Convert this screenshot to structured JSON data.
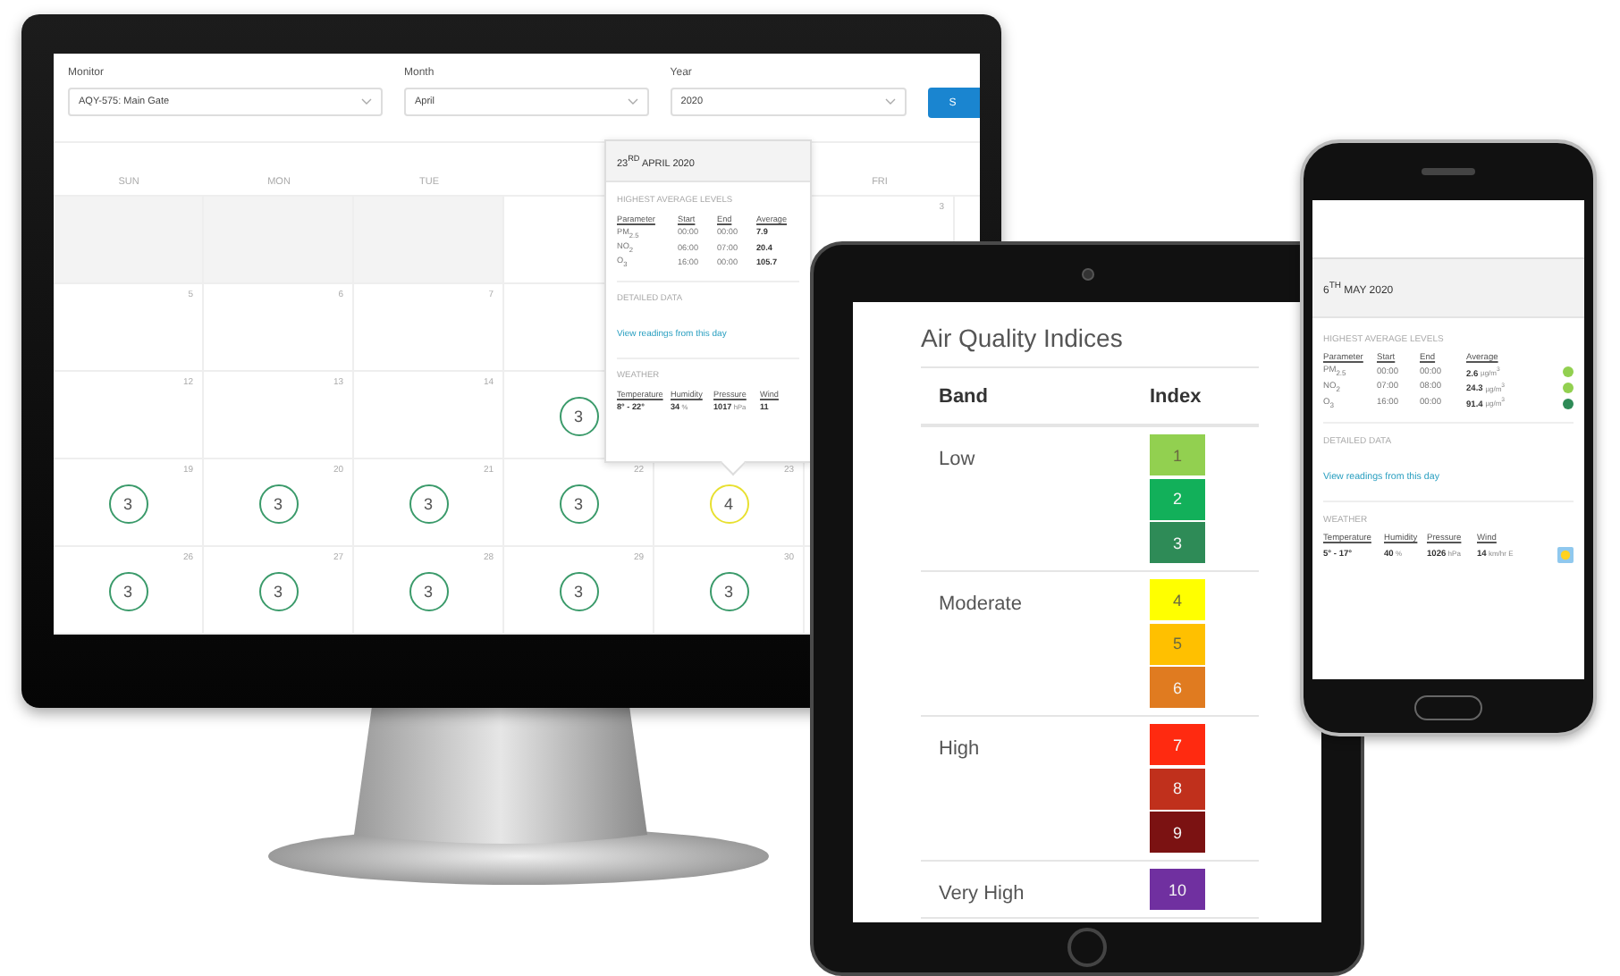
{
  "monitor": {
    "filters": [
      {
        "label": "Monitor",
        "value": "AQY-575: Main Gate"
      },
      {
        "label": "Month",
        "value": "April"
      },
      {
        "label": "Year",
        "value": "2020"
      }
    ],
    "submit_button": "S",
    "calendar": {
      "weekdays": [
        "SUN",
        "MON",
        "TUE",
        "FRI"
      ],
      "weeks": [
        {
          "days": [
            {
              "muted": true
            },
            {
              "muted": true
            },
            {
              "muted": true
            },
            {
              "muted": false
            }
          ],
          "end_days": [
            {
              "muted": false,
              "date": "3"
            }
          ]
        },
        {
          "days": [
            {
              "muted": false,
              "date": "5"
            },
            {
              "muted": false,
              "date": "6"
            },
            {
              "muted": false,
              "date": "7"
            },
            {
              "muted": false
            }
          ]
        },
        {
          "days": [
            {
              "muted": false,
              "date": "12"
            },
            {
              "muted": false,
              "date": "13"
            },
            {
              "muted": false,
              "date": "14"
            },
            {
              "muted": false,
              "index": "3",
              "color": "#3a9a6a"
            }
          ]
        },
        {
          "days": [
            {
              "muted": false,
              "date": "19",
              "index": "3",
              "color": "#3a9a6a"
            },
            {
              "muted": false,
              "date": "20",
              "index": "3",
              "color": "#3a9a6a"
            },
            {
              "muted": false,
              "date": "21",
              "index": "3",
              "color": "#3a9a6a"
            },
            {
              "muted": false,
              "date": "22",
              "index": "3",
              "color": "#3a9a6a"
            },
            {
              "muted": false,
              "date": "23",
              "index": "4",
              "color": "#e8e030"
            }
          ]
        },
        {
          "days": [
            {
              "muted": false,
              "date": "26",
              "index": "3",
              "color": "#3a9a6a"
            },
            {
              "muted": false,
              "date": "27",
              "index": "3",
              "color": "#3a9a6a"
            },
            {
              "muted": false,
              "date": "28",
              "index": "3",
              "color": "#3a9a6a"
            },
            {
              "muted": false,
              "date": "29",
              "index": "3",
              "color": "#3a9a6a"
            },
            {
              "muted": false,
              "date": "30",
              "index": "3",
              "color": "#3a9a6a"
            }
          ]
        }
      ]
    },
    "popover": {
      "date": "23$^{RD}$ APRIL 2020",
      "levels_heading": "HIGHEST AVERAGE LEVELS",
      "columns": [
        "Parameter",
        "Start",
        "End",
        "Average"
      ],
      "rows": [
        {
          "parameter": "PM$_{2.5}$",
          "start": "00:00",
          "end": "00:00",
          "average": "7.9"
        },
        {
          "parameter": "NO$_{2}$",
          "start": "06:00",
          "end": "07:00",
          "average": "20.4"
        },
        {
          "parameter": "O$_{3}$",
          "start": "16:00",
          "end": "00:00",
          "average": "105.7"
        }
      ],
      "detail_heading": "DETAILED DATA",
      "detail_link": "View readings from this day",
      "weather_heading": "WEATHER",
      "weather_columns": [
        "Temperature",
        "Humidity",
        "Pressure",
        "Wind"
      ],
      "weather_values": [
        {
          "value": "8° - 22°"
        },
        {
          "value": "34",
          "unit": "%"
        },
        {
          "value": "1017",
          "unit": "hPa"
        },
        {
          "value": "11"
        }
      ]
    }
  },
  "tablet": {
    "title": "Air Quality Indices",
    "columns": [
      "Band",
      "Index"
    ],
    "bands": [
      {
        "name": "Low",
        "indices": [
          {
            "label": "1",
            "color": "#92d050"
          },
          {
            "label": "2",
            "color": "#12b05a"
          },
          {
            "label": "3",
            "color": "#2e8b57"
          }
        ]
      },
      {
        "name": "Moderate",
        "indices": [
          {
            "label": "4",
            "color": "#ffff00"
          },
          {
            "label": "5",
            "color": "#ffc000"
          },
          {
            "label": "6",
            "color": "#e07b20"
          }
        ]
      },
      {
        "name": "High",
        "indices": [
          {
            "label": "7",
            "color": "#ff2a10"
          },
          {
            "label": "8",
            "color": "#c0301c"
          },
          {
            "label": "9",
            "color": "#7b1212"
          }
        ]
      },
      {
        "name": "Very High",
        "indices": [
          {
            "label": "10",
            "color": "#7030a0"
          }
        ]
      }
    ]
  },
  "phone": {
    "date": "6$^{TH}$ MAY 2020",
    "levels_heading": "HIGHEST AVERAGE LEVELS",
    "columns": [
      "Parameter",
      "Start",
      "End",
      "Average"
    ],
    "rows": [
      {
        "parameter": "PM$_{2.5}$",
        "start": "00:00",
        "end": "00:00",
        "average": "2.6",
        "unit": "µg/m$^{3}$",
        "color": "#92d050"
      },
      {
        "parameter": "NO$_{2}$",
        "start": "07:00",
        "end": "08:00",
        "average": "24.3",
        "unit": "µg/m$^{3}$",
        "color": "#92d050"
      },
      {
        "parameter": "O$_{3}$",
        "start": "16:00",
        "end": "00:00",
        "average": "91.4",
        "unit": "µg/m$^{3}$",
        "color": "#2e8b57"
      }
    ],
    "detail_heading": "DETAILED DATA",
    "detail_link": "View readings from this day",
    "weather_heading": "WEATHER",
    "weather_columns": [
      "Temperature",
      "Humidity",
      "Pressure",
      "Wind"
    ],
    "weather_values": [
      {
        "value": "5° - 17°"
      },
      {
        "value": "40",
        "unit": "%"
      },
      {
        "value": "1026",
        "unit": "hPa"
      },
      {
        "value": "14",
        "unit": "km/hr E"
      }
    ]
  }
}
